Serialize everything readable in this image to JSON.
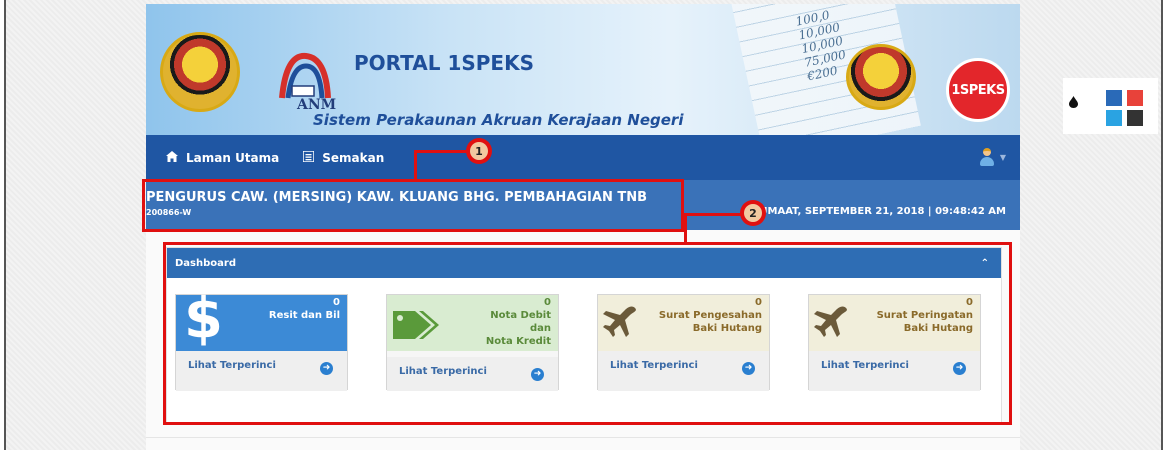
{
  "banner": {
    "title": "PORTAL 1SPEKS",
    "subtitle": "Sistem Perakaunan Akruan Kerajaan Negeri",
    "anm_label": "ANM",
    "brand_label": "1SPEKS",
    "sheet_numbers": [
      "100,0",
      "10,000",
      "10,000",
      "75,000",
      "€200"
    ]
  },
  "nav": {
    "items": [
      {
        "icon": "home-icon",
        "label": "Laman Utama"
      },
      {
        "icon": "list-icon",
        "label": "Semakan"
      }
    ],
    "user_icon": "user-avatar-icon"
  },
  "org": {
    "name": "PENGURUS CAW. (MERSING) KAW. KLUANG BHG. PEMBAHAGIAN TNB",
    "code": "200866-W",
    "datetime": "JUMAAT, SEPTEMBER 21, 2018 | 09:48:42 AM"
  },
  "dashboard": {
    "title": "Dashboard",
    "collapse_icon": "chevron-up-icon",
    "cards": [
      {
        "count": "0",
        "title_lines": [
          "Resit dan Bil"
        ],
        "link": "Lihat Terperinci",
        "icon": "dollar-icon",
        "color": "blue"
      },
      {
        "count": "0",
        "title_lines": [
          "Nota Debit",
          "dan",
          "Nota Kredit"
        ],
        "link": "Lihat Terperinci",
        "icon": "tag-icon",
        "color": "green"
      },
      {
        "count": "0",
        "title_lines": [
          "Surat Pengesahan",
          "Baki Hutang"
        ],
        "link": "Lihat Terperinci",
        "icon": "plane-icon",
        "color": "tan"
      },
      {
        "count": "0",
        "title_lines": [
          "Surat Peringatan",
          "Baki Hutang"
        ],
        "link": "Lihat Terperinci",
        "icon": "plane-icon",
        "color": "tan"
      }
    ]
  },
  "callouts": [
    "1",
    "2"
  ],
  "palette": {
    "icon": "ink-drop-icon",
    "colors": [
      "#2a6ab8",
      "#e8423a",
      "#2aa3e2",
      "#333333"
    ]
  }
}
